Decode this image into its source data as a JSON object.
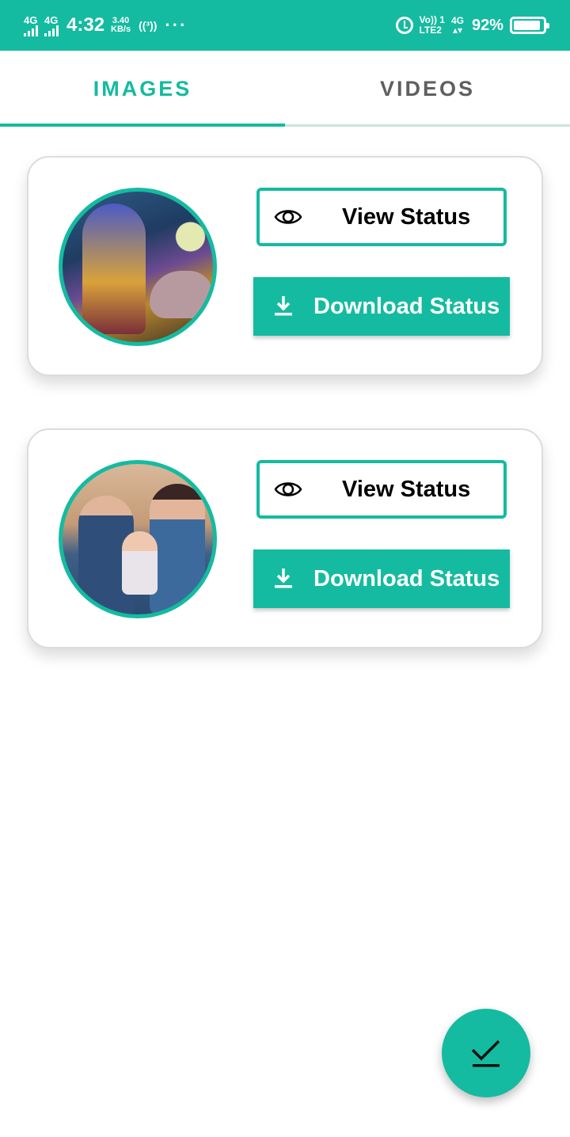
{
  "status_bar": {
    "sim1": "4G",
    "sim2": "4G",
    "time": "4:32",
    "speed_value": "3.40",
    "speed_unit": "KB/s",
    "hotspot": "((³))",
    "more": "···",
    "volte_line1": "Vo)) 1",
    "volte_line2": "LTE2",
    "net_type": "4G",
    "net_arrows": "▴▾",
    "battery_pct": "92%",
    "battery_level": 0.92
  },
  "tabs": [
    {
      "label": "IMAGES",
      "active": true
    },
    {
      "label": "VIDEOS",
      "active": false
    }
  ],
  "cards": [
    {
      "view_label": "View Status",
      "download_label": "Download Status",
      "view_icon": "eye-icon",
      "download_icon": "download-icon"
    },
    {
      "view_label": "View Status",
      "download_label": "Download Status",
      "view_icon": "eye-icon",
      "download_icon": "download-icon"
    }
  ],
  "fab": {
    "icon": "check-download-icon"
  },
  "colors": {
    "accent": "#14bba0",
    "inactive_tab": "#5f5f5f"
  }
}
